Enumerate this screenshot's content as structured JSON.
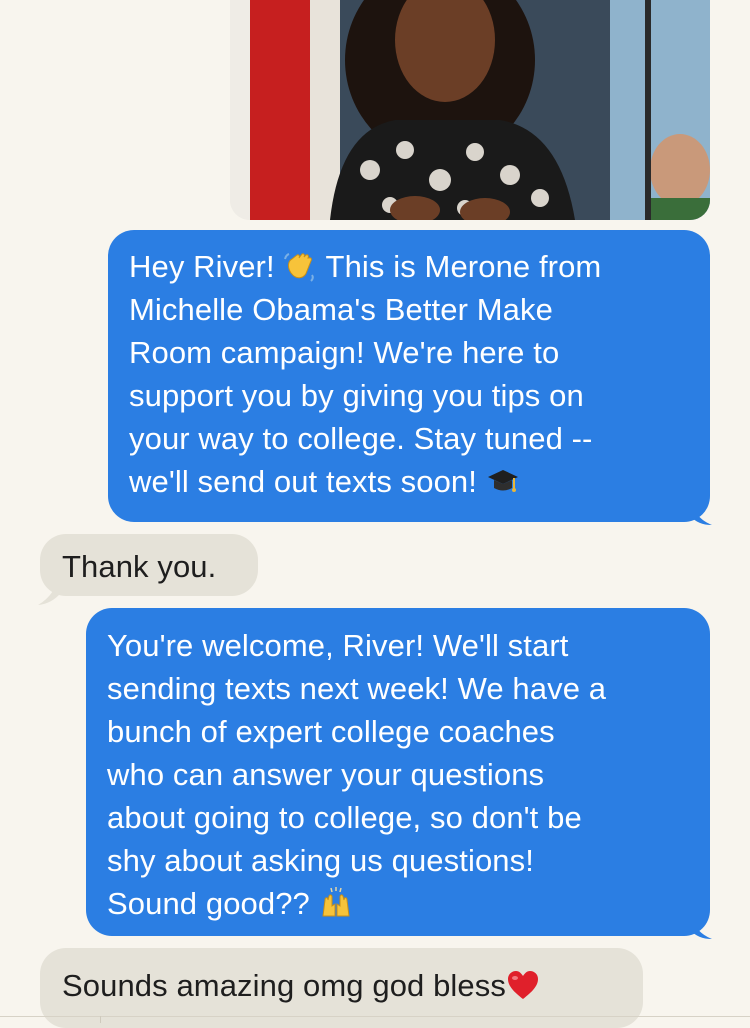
{
  "messages": [
    {
      "direction": "outgoing",
      "parts": [
        "Hey River! ",
        " This is Merone from\nMichelle Obama's Better Make\nRoom campaign! We're here to\nsupport you by giving you tips on\nyour way to college. Stay tuned --\nwe'll send out texts soon! "
      ],
      "emojis": [
        "waving-hand",
        "graduation-cap"
      ]
    },
    {
      "direction": "incoming",
      "text": "Thank you."
    },
    {
      "direction": "outgoing",
      "text": "You're welcome, River! We'll start\nsending texts next week! We have a\nbunch of expert college coaches\nwho can answer your questions\nabout going to college, so don't be\nshy about asking us questions!\nSound good?? ",
      "emojis": [
        "raising-hands"
      ]
    },
    {
      "direction": "incoming",
      "text": "Sounds amazing omg god bless",
      "emojis": [
        "red-heart"
      ]
    }
  ],
  "colors": {
    "background": "#f8f5ee",
    "outgoing_bubble": "#2b7ee3",
    "incoming_bubble": "#e5e2d8"
  }
}
